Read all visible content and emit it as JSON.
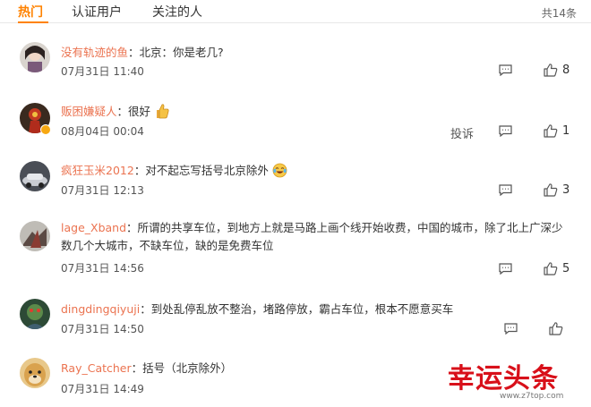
{
  "tabs": [
    {
      "label": "热门",
      "active": true
    },
    {
      "label": "认证用户",
      "active": false
    },
    {
      "label": "关注的人",
      "active": false
    }
  ],
  "total": "共14条",
  "colors": {
    "accent": "#ff8200",
    "username": "#eb7350",
    "verified": "#f7a812",
    "watermark": "#d8101a"
  },
  "comments": [
    {
      "user": "没有轨迹的鱼",
      "sep": "：",
      "text": "北京：你是老几?",
      "time": "07月31日 11:40",
      "likes": "8"
    },
    {
      "user": "贩困嫌疑人",
      "sep": "：",
      "text": "很好",
      "emoji": "thumbs-up-emoji",
      "time": "08月04日 00:04",
      "likes": "1",
      "report": "投诉",
      "verified": true
    },
    {
      "user": "疯狂玉米2012",
      "sep": "：",
      "text": "对不起忘写括号北京除外",
      "emoji": "laughing-tears-emoji",
      "time": "07月31日 12:13",
      "likes": "3"
    },
    {
      "user": "lage_Xband",
      "sep": "：",
      "text": "所谓的共享车位，到地方上就是马路上画个线开始收费，中国的城市，除了北上广深少数几个大城市，不缺车位，缺的是免费车位",
      "time": "07月31日 14:56",
      "likes": "5"
    },
    {
      "user": "dingdingqiyuji",
      "sep": "：",
      "text": "到处乱停乱放不整治，堵路停放，霸占车位，根本不愿意买车",
      "time": "07月31日 14:50",
      "likes": ""
    },
    {
      "user": "Ray_Catcher",
      "sep": "：",
      "text": "括号（北京除外）",
      "time": "07月31日 14:49",
      "likes": ""
    }
  ],
  "watermark": {
    "title": "幸运头条",
    "url": "www.z7top.com"
  }
}
